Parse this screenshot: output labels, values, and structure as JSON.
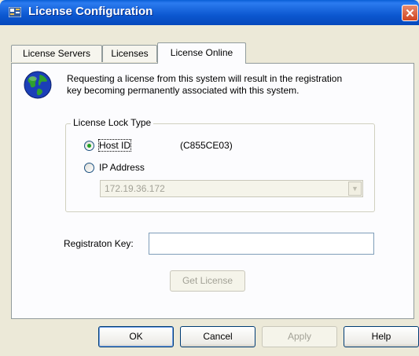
{
  "window": {
    "title": "License Configuration",
    "close_glyph": "✕"
  },
  "tabs": [
    {
      "label": "License Servers",
      "active": false
    },
    {
      "label": "Licenses",
      "active": false
    },
    {
      "label": "License Online",
      "active": true
    }
  ],
  "info": {
    "icon": "globe-icon",
    "text_line1": "Requesting a license from this system will result in the registration",
    "text_line2": "key becoming permanently associated with this system."
  },
  "lock_type": {
    "group_label": "License Lock Type",
    "host_id_label": "Host ID",
    "host_id_value": "(C855CE03)",
    "host_id_selected": true,
    "ip_label": "IP Address",
    "ip_selected": false,
    "ip_value": "172.19.36.172"
  },
  "registration": {
    "label": "Registraton Key:",
    "value": "",
    "get_license_label": "Get License"
  },
  "footer": {
    "ok_label": "OK",
    "cancel_label": "Cancel",
    "apply_label": "Apply",
    "help_label": "Help"
  },
  "colors": {
    "titlebar": "#0A5FD6",
    "dialog_bg": "#ECE9D8",
    "panel_bg": "#FCFCFE",
    "disabled_text": "#A2A196",
    "close_button": "#D1441F"
  }
}
